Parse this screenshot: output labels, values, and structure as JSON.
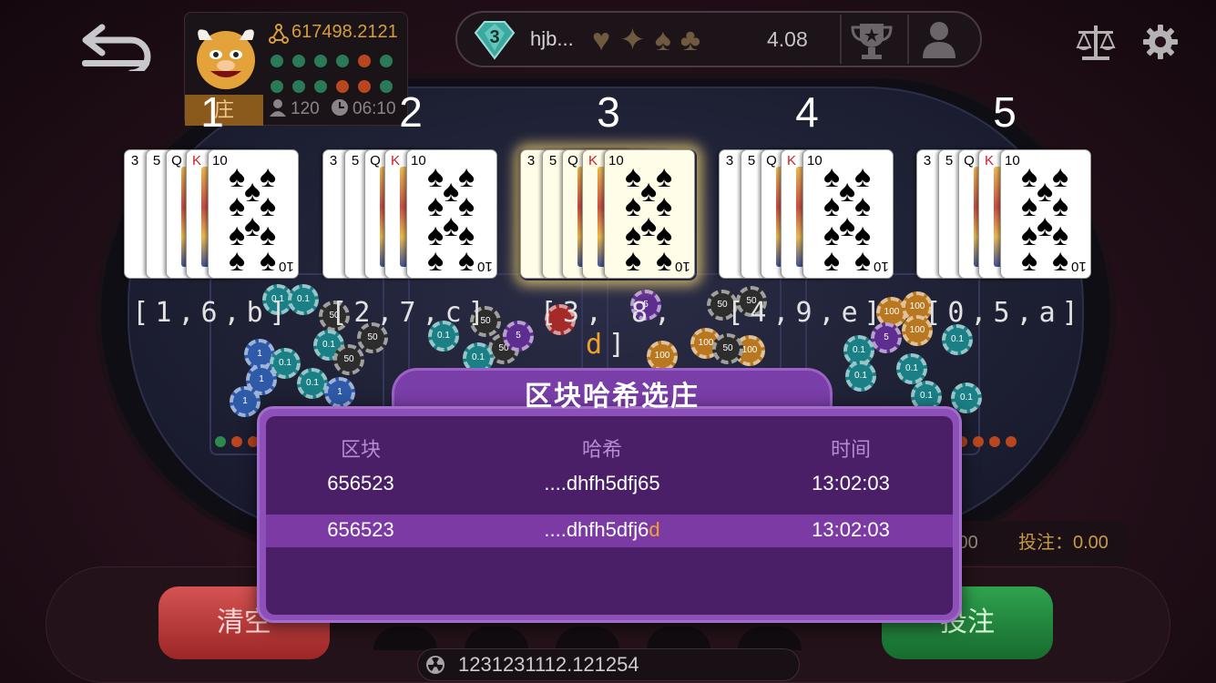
{
  "header": {
    "player": {
      "balance": "617498.2121",
      "dealer_tag": "庄",
      "player_count": "120",
      "timer": "06:10"
    },
    "room": {
      "level": "3",
      "name": "hjb...",
      "suits": [
        "♥",
        "✦",
        "♠",
        "♣"
      ],
      "odds": "4.08"
    }
  },
  "seats": [
    {
      "number": "1",
      "code_parts": [
        "[1,6,b]"
      ],
      "cards": [
        "3",
        "5",
        "Q",
        "K",
        "10"
      ]
    },
    {
      "number": "2",
      "code_parts": [
        "[2,7,c]"
      ],
      "cards": [
        "3",
        "5",
        "Q",
        "K",
        "10"
      ]
    },
    {
      "number": "3",
      "code_parts": [
        "[3, 8, ",
        "d",
        "]"
      ],
      "cards": [
        "3",
        "5",
        "Q",
        "K",
        "10"
      ],
      "highlighted": true
    },
    {
      "number": "4",
      "code_parts": [
        "[4,9,e]"
      ],
      "cards": [
        "3",
        "5",
        "Q",
        "K",
        "10"
      ]
    },
    {
      "number": "5",
      "code_parts": [
        "[0,5,a]"
      ],
      "cards": [
        "3",
        "5",
        "Q",
        "K",
        "10"
      ]
    }
  ],
  "modal": {
    "title": "区块哈希选庄",
    "headers": [
      "区块",
      "哈希",
      "时间"
    ],
    "rows": [
      {
        "block": "656523",
        "hash": "....dhfh5dfj65",
        "hash_suffix": "",
        "time": "13:02:03"
      },
      {
        "block": "656523",
        "hash": "....dhfh5dfj6",
        "hash_suffix": "d",
        "time": "13:02:03"
      }
    ]
  },
  "controls": {
    "clear_label": "清空",
    "bet_label": "投注",
    "bet_info_left": ".00",
    "bet_info_right": "投注：0.00",
    "hash_value": "1231231112.121254"
  },
  "colors": {
    "accent_gold": "#d69c3e",
    "highlight_orange": "#f2a02c",
    "modal_purple": "#8d4fb8",
    "modal_inner": "#4a1f68",
    "clear_red": "#c23b3b",
    "bet_green": "#2fa24e"
  },
  "icons": {
    "back": "back-arrow-icon",
    "trophy": "trophy-icon",
    "profile": "person-icon",
    "balance": "scale-icon",
    "settings": "gear-icon"
  }
}
